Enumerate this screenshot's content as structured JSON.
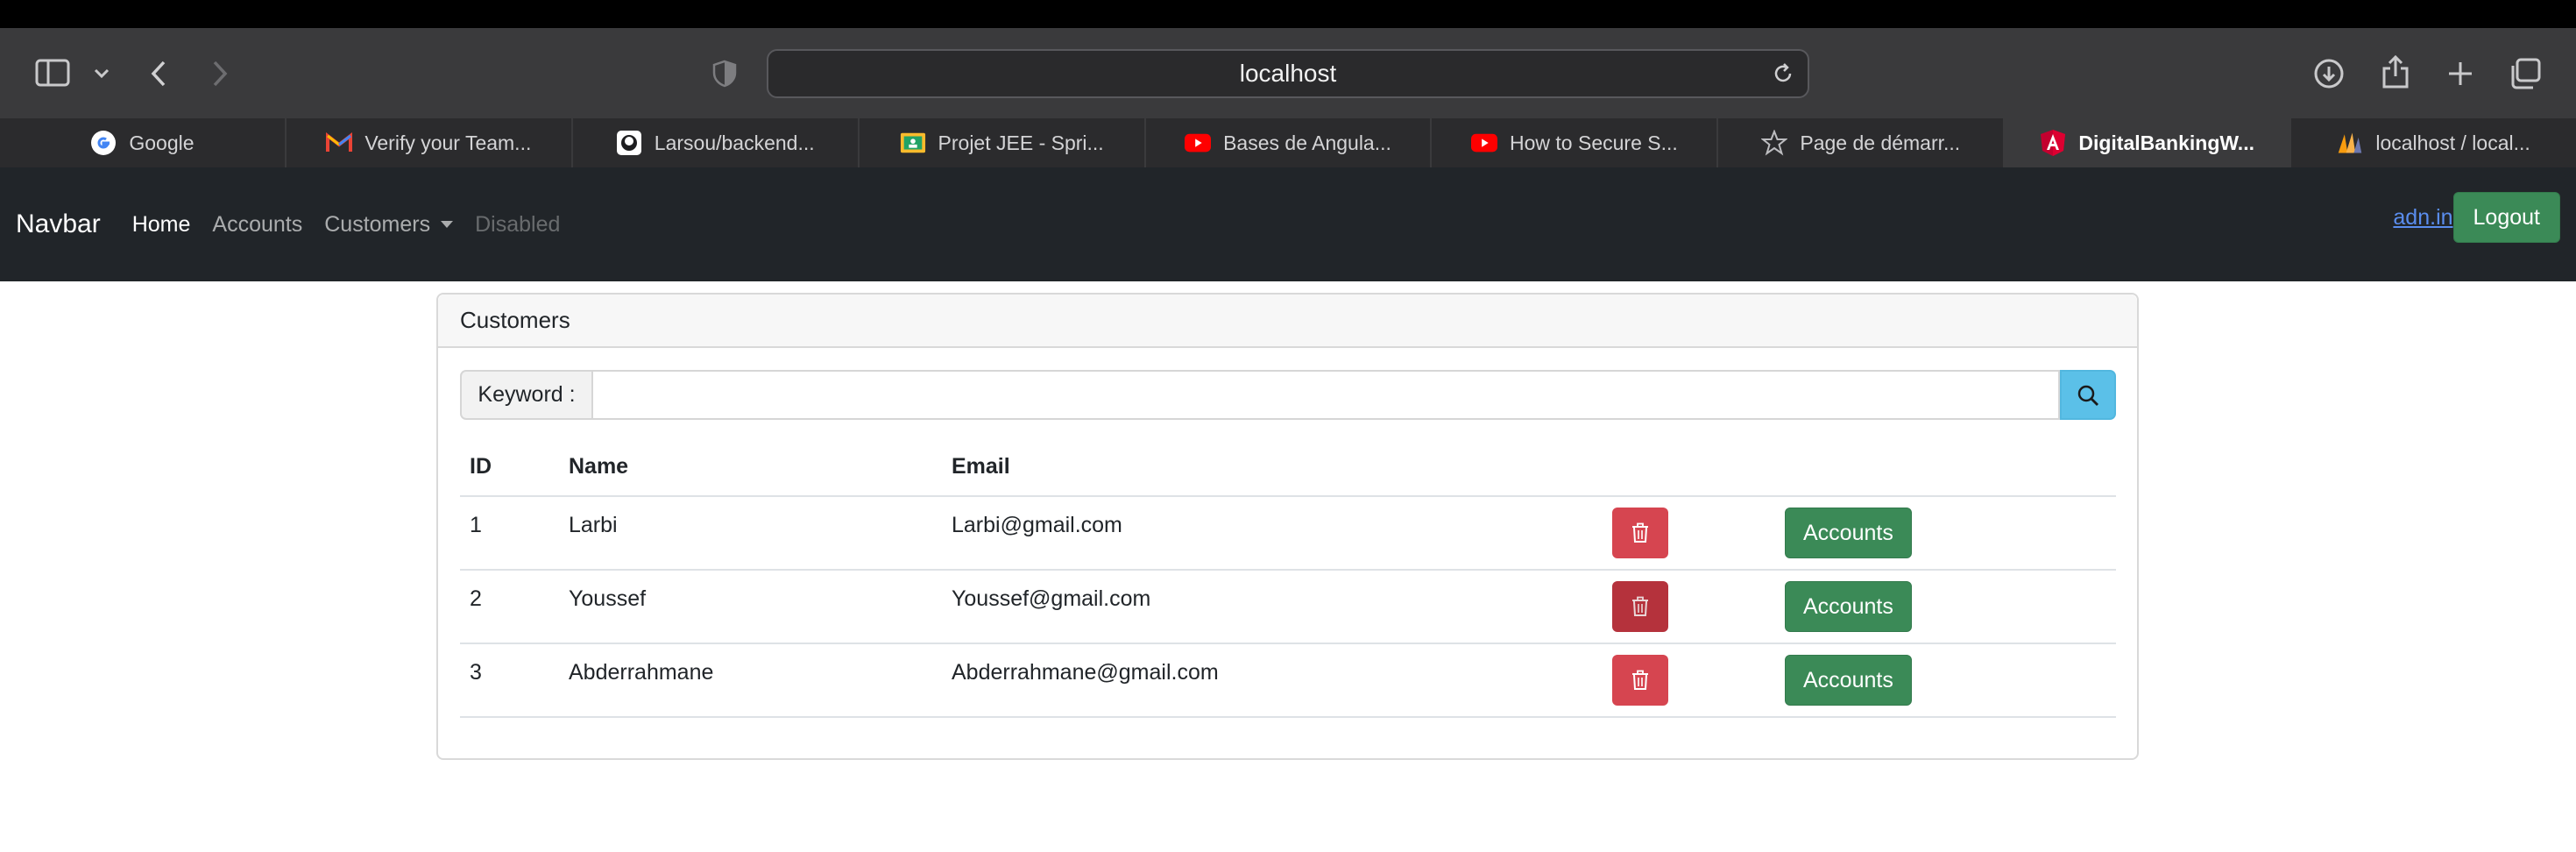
{
  "browser": {
    "url": "localhost",
    "tabs": [
      {
        "label": "Google",
        "icon": "google-icon",
        "active": false
      },
      {
        "label": "Verify your Team...",
        "icon": "gmail-icon",
        "active": false
      },
      {
        "label": "Larsou/backend...",
        "icon": "github-icon",
        "active": false
      },
      {
        "label": "Projet JEE - Spri...",
        "icon": "classroom-icon",
        "active": false
      },
      {
        "label": "Bases de Angula...",
        "icon": "youtube-icon",
        "active": false
      },
      {
        "label": "How to Secure S...",
        "icon": "youtube-icon",
        "active": false
      },
      {
        "label": "Page de démarr...",
        "icon": "star-icon",
        "active": false
      },
      {
        "label": "DigitalBankingW...",
        "icon": "angular-icon",
        "active": true
      },
      {
        "label": "localhost / local...",
        "icon": "phpmyadmin-icon",
        "active": false
      }
    ]
  },
  "navbar": {
    "brand": "Navbar",
    "links": {
      "home": "Home",
      "accounts": "Accounts",
      "customers": "Customers",
      "disabled": "Disabled"
    },
    "user_link": "adn.in",
    "logout": "Logout"
  },
  "customers_card": {
    "title": "Customers",
    "search_label": "Keyword :",
    "search_value": "",
    "columns": {
      "id": "ID",
      "name": "Name",
      "email": "Email"
    },
    "rows": [
      {
        "id": "1",
        "name": "Larbi",
        "email": "Larbi@gmail.com",
        "accounts_label": "Accounts"
      },
      {
        "id": "2",
        "name": "Youssef",
        "email": "Youssef@gmail.com",
        "accounts_label": "Accounts"
      },
      {
        "id": "3",
        "name": "Abderrahmane",
        "email": "Abderrahmane@gmail.com",
        "accounts_label": "Accounts"
      }
    ]
  },
  "colors": {
    "navbar_bg": "#212529",
    "success": "#3b8a57",
    "danger": "#d64550",
    "info": "#5bc0e8"
  }
}
